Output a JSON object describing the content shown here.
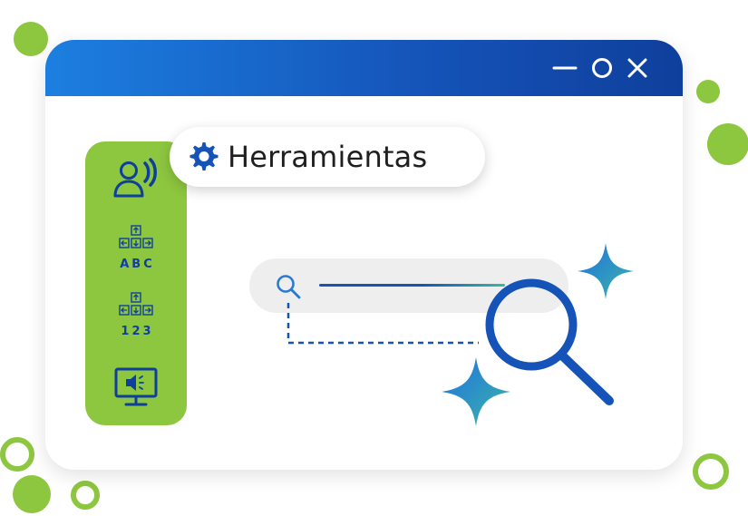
{
  "window": {
    "controls": {
      "minimize_icon": "minimize-icon",
      "maximize_icon": "circle-icon",
      "close_icon": "close-icon"
    }
  },
  "tools_chip": {
    "icon": "gear-icon",
    "label": "Herramientas"
  },
  "sidebar": {
    "tools": [
      {
        "icon": "voice-reader-icon",
        "label": ""
      },
      {
        "icon": "arrow-keys-icon",
        "label": "ABC"
      },
      {
        "icon": "arrow-keys-icon",
        "label": "123"
      },
      {
        "icon": "audio-monitor-icon",
        "label": ""
      }
    ]
  },
  "search": {
    "icon": "search-icon",
    "magnifier_icon": "magnifier-icon"
  },
  "colors": {
    "accent_green": "#8dc63f",
    "primary_blue": "#1553b8",
    "titlebar_gradient_start": "#1c7fe0",
    "titlebar_gradient_end": "#0f3f9c",
    "sparkle_teal": "#3bb7a8"
  }
}
